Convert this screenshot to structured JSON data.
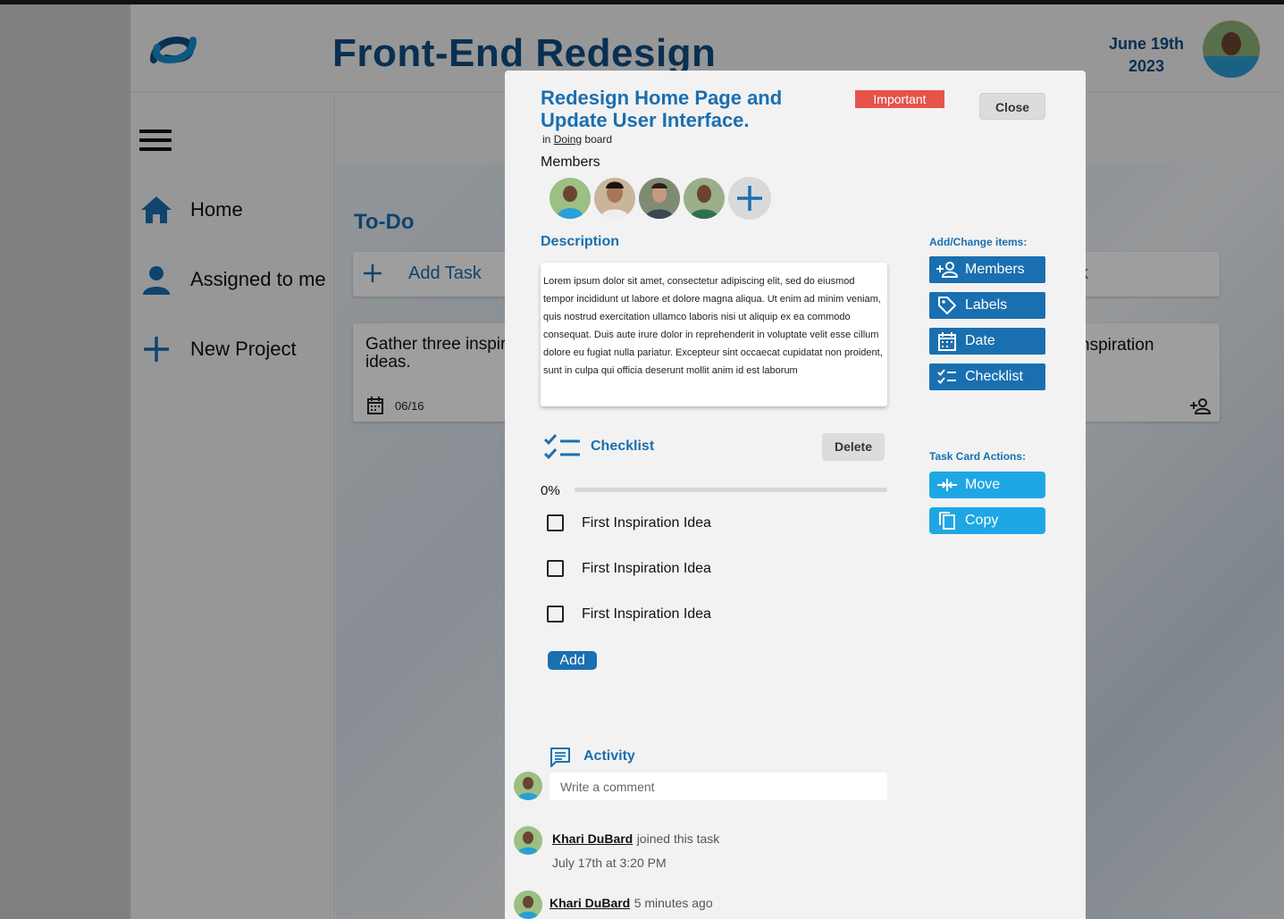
{
  "app": {
    "project_title": "Front-End Redesign",
    "date_line1": "June 19th",
    "date_line2": "2023"
  },
  "sidebar": {
    "items": [
      {
        "label": "Home",
        "icon": "home-icon"
      },
      {
        "label": "Assigned to me",
        "icon": "person-icon"
      },
      {
        "label": "New Project",
        "icon": "plus-icon"
      }
    ]
  },
  "board": {
    "column_title": "To-Do",
    "add_task_label": "Add Task",
    "card_text": "Gather three inspiration ideas.",
    "card_date": "06/16",
    "right_card_text": "nspiration",
    "right_add_task_fragment": "k"
  },
  "modal": {
    "title": "Redesign Home Page and Update User Interface.",
    "badge": "Important",
    "close_label": "Close",
    "board_prefix": "in",
    "board_name": "Doing",
    "board_suffix": "board",
    "members_label": "Members",
    "description_label": "Description",
    "description_text": "Lorem ipsum dolor sit amet, consectetur adipiscing elit, sed do eiusmod tempor incididunt ut labore et dolore magna aliqua. Ut enim ad minim veniam, quis nostrud exercitation ullamco laboris nisi ut aliquip ex ea commodo consequat. Duis aute irure dolor in reprehenderit in voluptate velit esse cillum dolore eu fugiat nulla pariatur. Excepteur sint occaecat cupidatat non proident, sunt in culpa qui officia deserunt mollit anim id est laborum",
    "add_change_label": "Add/Change items:",
    "add_change_buttons": [
      {
        "label": "Members",
        "icon": "add-person-icon"
      },
      {
        "label": "Labels",
        "icon": "tag-icon"
      },
      {
        "label": "Date",
        "icon": "calendar-icon"
      },
      {
        "label": "Checklist",
        "icon": "checklist-icon"
      }
    ],
    "task_actions_label": "Task Card Actions:",
    "task_actions": [
      {
        "label": "Move",
        "icon": "move-icon"
      },
      {
        "label": "Copy",
        "icon": "copy-icon"
      }
    ],
    "checklist": {
      "label": "Checklist",
      "delete_label": "Delete",
      "progress_text": "0%",
      "progress": 0,
      "items": [
        "First Inspiration Idea",
        "First Inspiration Idea",
        "First Inspiration Idea"
      ],
      "add_label": "Add"
    },
    "activity": {
      "label": "Activity",
      "comment_placeholder": "Write a comment",
      "entries": [
        {
          "name": "Khari DuBard",
          "text": "joined this task",
          "time": "July 17th at 3:20 PM"
        },
        {
          "name": "Khari DuBard",
          "text": "5 minutes ago"
        }
      ]
    }
  },
  "colors": {
    "brand_blue": "#1a6fb0",
    "navy": "#0f4d83",
    "light_blue": "#1ea7e4",
    "important_red": "#e5534b"
  }
}
